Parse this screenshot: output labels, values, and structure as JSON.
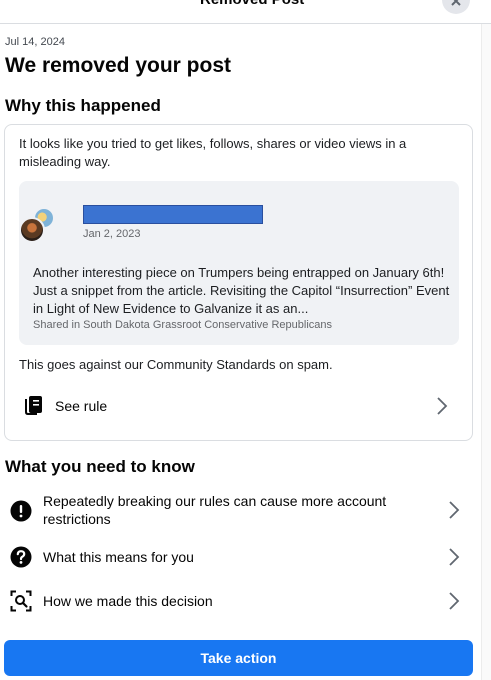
{
  "header": {
    "title": "Removed Post"
  },
  "notice": {
    "date": "Jul 14, 2024",
    "title": "We removed your post"
  },
  "why": {
    "heading": "Why this happened",
    "description": "It looks like you tried to get likes, follows, shares or video views in a misleading way.",
    "post": {
      "date": "Jan 2, 2023",
      "text": "Another interesting piece on Trumpers being entrapped on January 6th! Just a snippet from the article. Revisiting the Capitol “Insurrection” Event in Light of New Evidence to Galvanize it as an...",
      "shared_in": "Shared in South Dakota Grassroot Conservative Republicans"
    },
    "standards": "This goes against our Community Standards on spam.",
    "see_rule_label": "See rule"
  },
  "know": {
    "heading": "What you need to know",
    "items": [
      {
        "label": "Repeatedly breaking our rules can cause more account restrictions",
        "icon": "exclamation-icon"
      },
      {
        "label": "What this means for you",
        "icon": "question-icon"
      },
      {
        "label": "How we made this decision",
        "icon": "scan-search-icon"
      }
    ]
  },
  "actions": {
    "take_action_label": "Take action"
  },
  "colors": {
    "primary": "#1877f2",
    "redaction": "#3b73d1",
    "card_bg": "#f0f2f5"
  }
}
